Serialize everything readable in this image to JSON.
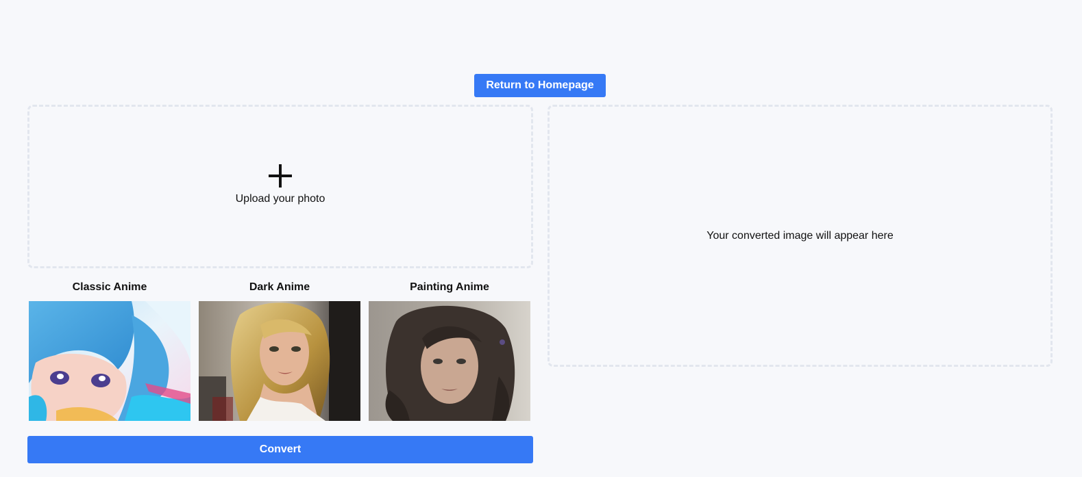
{
  "header": {
    "return_label": "Return to Homepage"
  },
  "upload": {
    "icon": "plus-icon",
    "label": "Upload your photo"
  },
  "output": {
    "placeholder": "Your converted image will appear here"
  },
  "styles": [
    {
      "label": "Classic Anime",
      "thumb": "classic-anime-thumbnail"
    },
    {
      "label": "Dark Anime",
      "thumb": "dark-anime-thumbnail"
    },
    {
      "label": "Painting Anime",
      "thumb": "painting-anime-thumbnail"
    }
  ],
  "actions": {
    "convert_label": "Convert"
  },
  "colors": {
    "accent": "#3679f5",
    "background": "#f7f8fb",
    "dashed_border": "#e2e6ee"
  }
}
